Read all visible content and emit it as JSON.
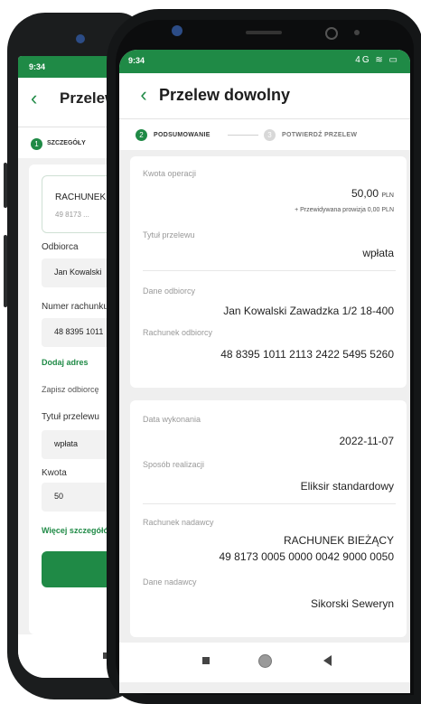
{
  "back_screen": {
    "status_time": "9:34",
    "title": "Przelew dowolny",
    "step_label": "SZCZEGÓŁY",
    "account_name": "RACHUNEK BIEŻĄCY",
    "account_number": "49 8173 ...",
    "recipient_label": "Odbiorca",
    "recipient_value": "Jan Kowalski",
    "account_label": "Numer rachunku",
    "account_value": "48 8395 1011",
    "add_address_link": "Dodaj adres",
    "save_recipient": "Zapisz odbiorcę",
    "title_label": "Tytuł przelewu",
    "title_value": "wpłata",
    "amount_label": "Kwota",
    "amount_value": "50",
    "more_details_link": "Więcej szczegółów"
  },
  "front_screen": {
    "status_time": "9:34",
    "status_icons": "4G ≋ ▭",
    "back_icon": "chevron-left-icon",
    "back_glyph": "‹",
    "title": "Przelew dowolny",
    "steps": [
      {
        "number": "2",
        "label": "PODSUMOWANIE"
      },
      {
        "number": "3",
        "label": "POTWIERDŹ PRZELEW"
      }
    ],
    "card1": {
      "amount_label": "Kwota operacji",
      "amount_value": "50,00",
      "currency": "PLN",
      "fee_note": "+ Przewidywana prowizja 0,00 PLN",
      "title_label": "Tytuł przelewu",
      "title_value": "wpłata",
      "recipient_label": "Dane odbiorcy",
      "recipient_value": "Jan Kowalski Zawadzka 1/2 18-400",
      "recipient_account_label": "Rachunek odbiorcy",
      "recipient_account_value": "48 8395 1011 2113 2422 5495 5260"
    },
    "card2": {
      "date_label": "Data wykonania",
      "date_value": "2022-11-07",
      "method_label": "Sposób realizacji",
      "method_value": "Eliksir standardowy",
      "sender_account_label": "Rachunek nadawcy",
      "sender_account_name": "RACHUNEK BIEŻĄCY",
      "sender_account_number": "49 8173 0005 0000 0042 9000 0050",
      "sender_label": "Dane nadawcy",
      "sender_value": "Sikorski Seweryn"
    }
  },
  "colors": {
    "accent": "#1f8a46",
    "background": "#efefef"
  }
}
